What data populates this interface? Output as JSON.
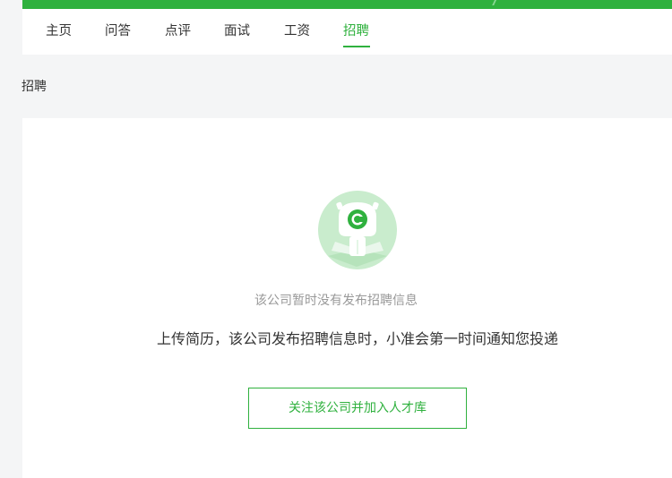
{
  "nav": {
    "tabs": [
      {
        "label": "主页"
      },
      {
        "label": "问答"
      },
      {
        "label": "点评"
      },
      {
        "label": "面试"
      },
      {
        "label": "工资"
      },
      {
        "label": "招聘"
      }
    ],
    "active_tab": "招聘"
  },
  "section": {
    "title": "招聘"
  },
  "empty_state": {
    "icon": "robot-mascot-icon",
    "title": "该公司暂时没有发布招聘信息",
    "description": "上传简历，该公司发布招聘信息时，小准会第一时间通知您投递",
    "button_label": "关注该公司并加入人才库"
  },
  "colors": {
    "accent": "#2fb13e",
    "background": "#f4f5f6",
    "text": "#333333",
    "muted": "#999999"
  }
}
